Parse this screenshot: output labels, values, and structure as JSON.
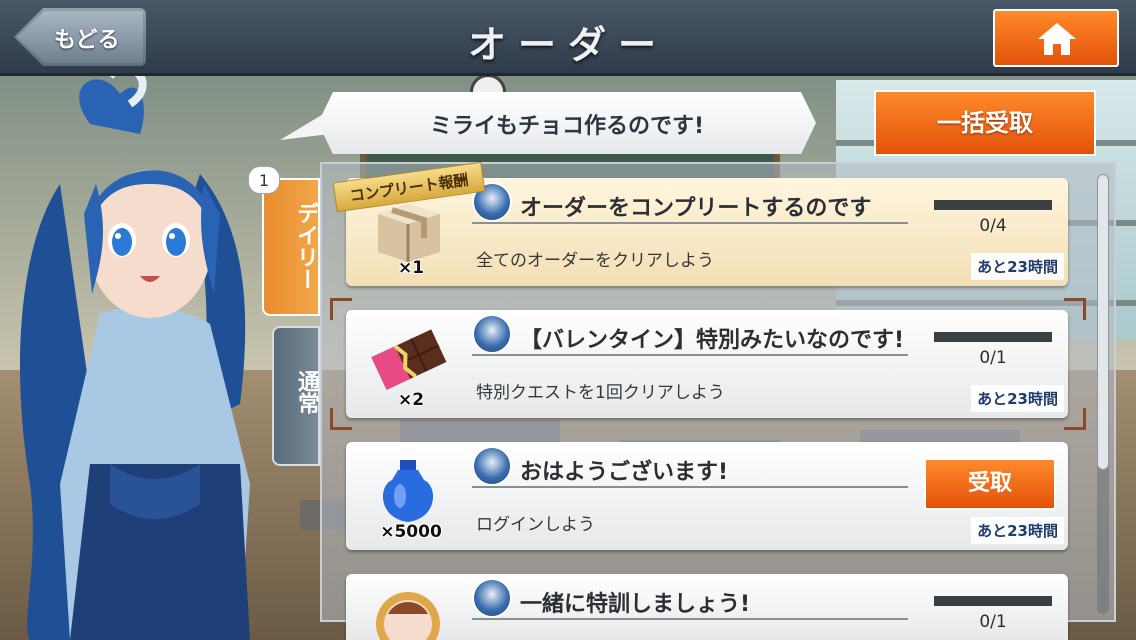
{
  "header": {
    "back_label": "もどる",
    "title": "オーダー"
  },
  "bubble": {
    "text": "ミライもチョコ作るのです!"
  },
  "bulk_claim_label": "一括受取",
  "tabs": {
    "badge": "1",
    "daily_label": "デイリー",
    "normal_label": "通常"
  },
  "ribbon_label": "コンプリート報酬",
  "orders": [
    {
      "title": "オーダーをコンプリートするのです",
      "description": "全てのオーダーをクリアしよう",
      "reward_icon": "present-box-icon",
      "quantity": "×1",
      "progress": "0/4",
      "progress_fraction": 0,
      "time_left": "あと23時間"
    },
    {
      "title": "【バレンタイン】特別みたいなのです!",
      "description": "特別クエストを1回クリアしよう",
      "reward_icon": "chocolate-bar-icon",
      "quantity": "×2",
      "progress": "0/1",
      "progress_fraction": 0,
      "time_left": "あと23時間"
    },
    {
      "title": "おはようございます!",
      "description": "ログインしよう",
      "reward_icon": "blue-potion-icon",
      "quantity": "×5000",
      "claim_label": "受取",
      "time_left": "あと23時間"
    },
    {
      "title": "一緒に特訓しましょう!",
      "reward_icon": "character-medal-icon",
      "progress": "0/1",
      "progress_fraction": 0
    }
  ],
  "colors": {
    "accent_orange": "#f07a1e",
    "header_dark": "#2f3b4a",
    "daily_tab": "#ee9a3c",
    "normal_tab": "#66778a"
  }
}
